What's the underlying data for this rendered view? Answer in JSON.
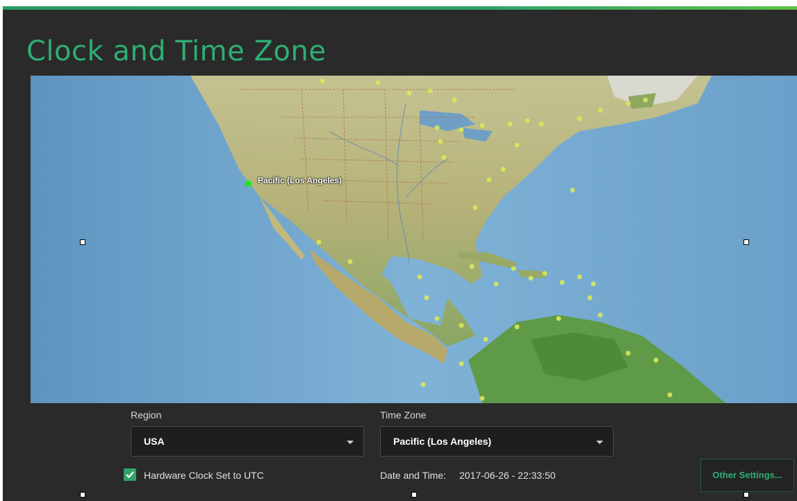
{
  "window": {
    "title": "Clock and Time Zone"
  },
  "map": {
    "selected_city": "Pacific (Los Angeles)",
    "selected_marker_color": "#19e619",
    "city_marker_color": "#d9e85a"
  },
  "region": {
    "label": "Region",
    "value": "USA"
  },
  "timezone": {
    "label": "Time Zone",
    "value": "Pacific (Los Angeles)"
  },
  "hardware_clock": {
    "label": "Hardware Clock Set to UTC",
    "checked": true
  },
  "datetime": {
    "label": "Date and Time:",
    "value": "2017-06-26 - 22:33:50"
  },
  "buttons": {
    "other_settings": "Other Settings..."
  },
  "colors": {
    "accent": "#2fae73",
    "background": "#2a2a2a",
    "field": "#1e1e1e"
  },
  "icons": [
    "check-icon",
    "chevron-down-icon"
  ]
}
